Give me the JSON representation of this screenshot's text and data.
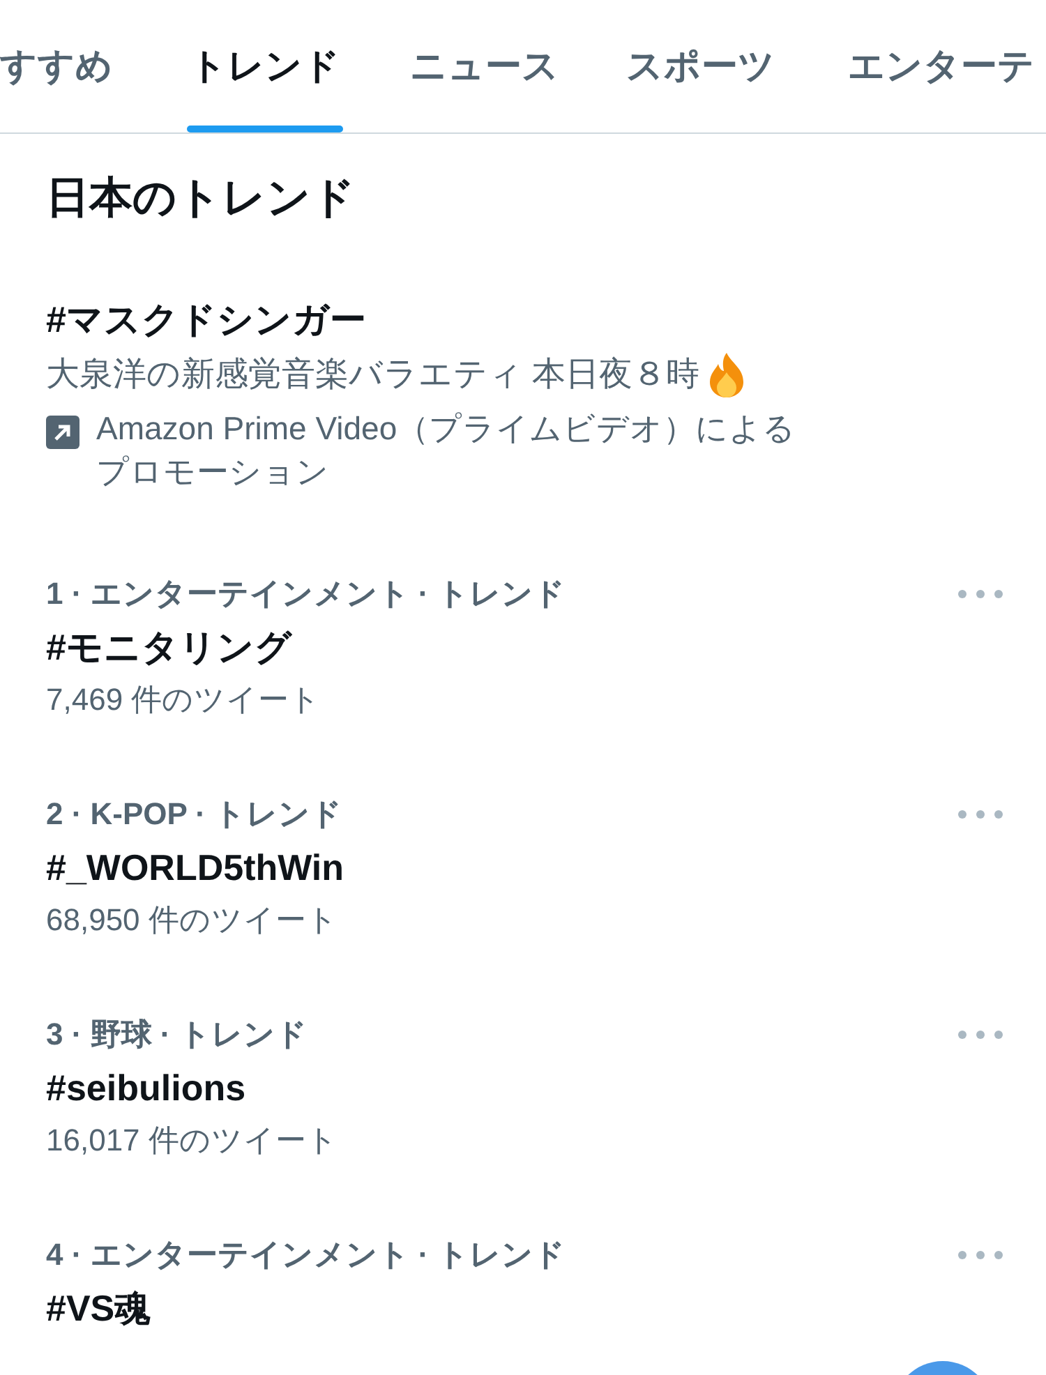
{
  "tabs": [
    {
      "label": "すすめ",
      "selected": false
    },
    {
      "label": "トレンド",
      "selected": true
    },
    {
      "label": "ニュース",
      "selected": false
    },
    {
      "label": "スポーツ",
      "selected": false
    },
    {
      "label": "エンターテ",
      "selected": false
    }
  ],
  "section_title": "日本のトレンド",
  "promoted": {
    "title": "#マスクドシンガー",
    "description": "大泉洋の新感覚音楽バラエティ 本日夜８時",
    "promoter": "Amazon Prime Video（プライムビデオ）による",
    "promoter_suffix": "プロモーション"
  },
  "trends": [
    {
      "meta": "1 · エンターテインメント · トレンド",
      "name": "#モニタリング",
      "count": "7,469 件のツイート"
    },
    {
      "meta": "2 · K-POP · トレンド",
      "name": "#_WORLD5thWin",
      "count": "68,950 件のツイート"
    },
    {
      "meta": "3 · 野球 · トレンド",
      "name": "#seibulions",
      "count": "16,017 件のツイート"
    },
    {
      "meta": "4 · エンターテインメント · トレンド",
      "name": "#VS魂"
    }
  ]
}
